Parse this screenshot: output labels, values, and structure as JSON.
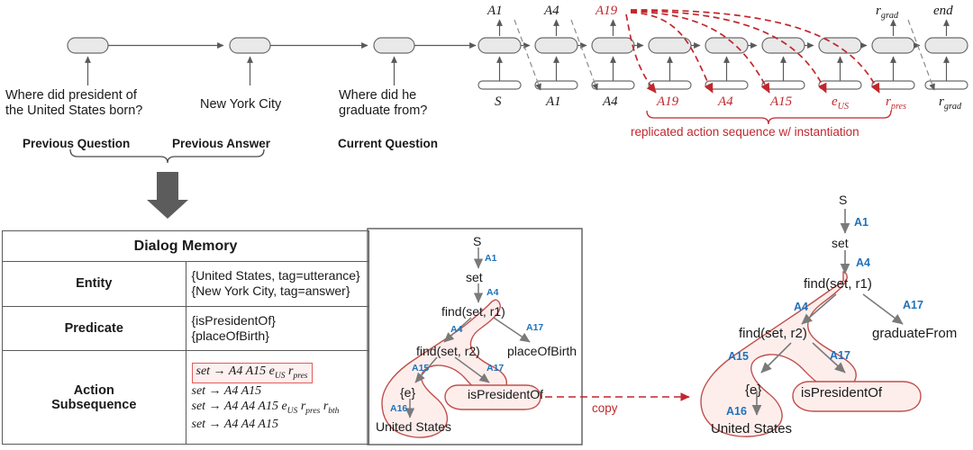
{
  "top_sequence": {
    "utterances": [
      {
        "text": "Where did president of\nthe United States born?",
        "role": "Previous Question"
      },
      {
        "text": "New York City",
        "role": "Previous Answer"
      },
      {
        "text": "Where did he\ngraduate from?",
        "role": "Current Question"
      }
    ],
    "decoder_outputs": [
      "A1",
      "A4",
      "A19",
      "r_grad",
      "end"
    ],
    "decoder_inputs": [
      "S",
      "A1",
      "A4",
      "A19",
      "A4",
      "A15",
      "e_US",
      "r_pres",
      "r_grad"
    ],
    "replicated_label": "replicated action sequence w/ instantiation",
    "accent_red": "#c1272d",
    "cell_fill": "#e9e9e9",
    "cell_stroke": "#6b6b6b"
  },
  "dialog_memory": {
    "title": "Dialog Memory",
    "rows": [
      {
        "label": "Entity",
        "lines": [
          "{United States, tag=utterance}",
          "{New York City, tag=answer}"
        ]
      },
      {
        "label": "Predicate",
        "lines": [
          "{isPresidentOf}",
          "{placeOfBirth}"
        ]
      },
      {
        "label": "Action\nSubsequence",
        "lines": [
          "set → A4 A15 e_US r_pres",
          "set → A4 A15",
          "set → A4 A4 A15 e_US r_pres r_bth",
          "set → A4 A4 A15"
        ],
        "highlighted_index": 0
      }
    ]
  },
  "tree_left": {
    "nodes": [
      "S",
      "set",
      "find(set, r1)",
      "find(set, r2)",
      "placeOfBirth",
      "{e}",
      "isPresidentOf",
      "United States"
    ],
    "edge_labels": [
      "A1",
      "A4",
      "A4",
      "A17",
      "A15",
      "A17",
      "A16"
    ],
    "highlight_color": "#fdeeec",
    "highlight_stroke": "#c0504d",
    "label_color": "#1f72bb"
  },
  "tree_right": {
    "nodes": [
      "S",
      "set",
      "find(set, r1)",
      "find(set, r2)",
      "graduateFrom",
      "{e}",
      "isPresidentOf",
      "United States"
    ],
    "edge_labels": [
      "A1",
      "A4",
      "A4",
      "A17",
      "A15",
      "A17",
      "A16"
    ]
  },
  "copy_label": "copy"
}
